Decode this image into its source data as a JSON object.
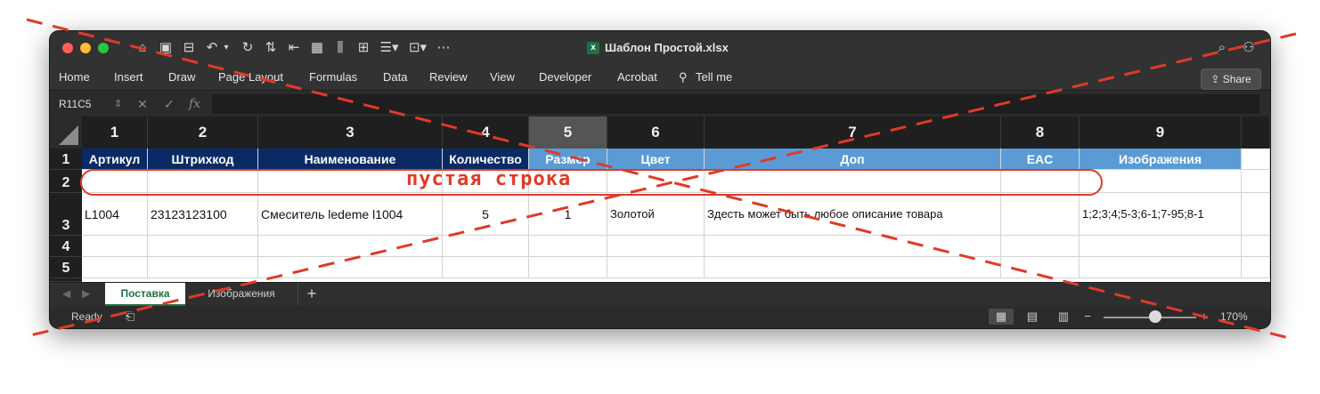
{
  "window": {
    "title": "Шаблон Простой.xlsx",
    "excel_icon": "excel-file-icon",
    "quick_access": [
      "home-icon",
      "save-icon",
      "save-as-icon",
      "undo-icon",
      "chevron-down-icon",
      "redo-icon",
      "text-direction-icon",
      "indent-icon",
      "table-icon",
      "align-icon",
      "insert-icon",
      "format-icon",
      "sort-icon",
      "more-icon"
    ]
  },
  "menu": {
    "items": [
      "Home",
      "Insert",
      "Draw",
      "Page Layout",
      "Formulas",
      "Data",
      "Review",
      "View",
      "Developer",
      "Acrobat",
      "Tell me"
    ],
    "share_label": "Share"
  },
  "formula_bar": {
    "name_box": "R11C5",
    "fx": "fx",
    "value": ""
  },
  "grid": {
    "column_numbers": [
      "1",
      "2",
      "3",
      "4",
      "5",
      "6",
      "7",
      "8",
      "9"
    ],
    "row_numbers": [
      "1",
      "2",
      "3",
      "4",
      "5"
    ],
    "header_row": [
      "Артикул",
      "Штрихкод",
      "Наименование",
      "Количество",
      "Размер",
      "Цвет",
      "Доп",
      "EAC",
      "Изображения"
    ],
    "data_row": [
      "L1004",
      "23123123100",
      "Смеситель ledeme l1004",
      "5",
      "1",
      "Золотой",
      "Здесть может быть любое описание товара",
      "",
      "1;2;3;4;5-3;6-1;7-95;8-1"
    ],
    "empty_row_annotation": "пустая строка",
    "colors": {
      "dark_header": "#0a2a66",
      "light_header": "#5b9bd5",
      "annotation": "#e03a28"
    }
  },
  "sheets": {
    "active": "Поставка",
    "inactive": "Изображения",
    "add_label": "+"
  },
  "status": {
    "text": "Ready",
    "zoom": "170%"
  }
}
